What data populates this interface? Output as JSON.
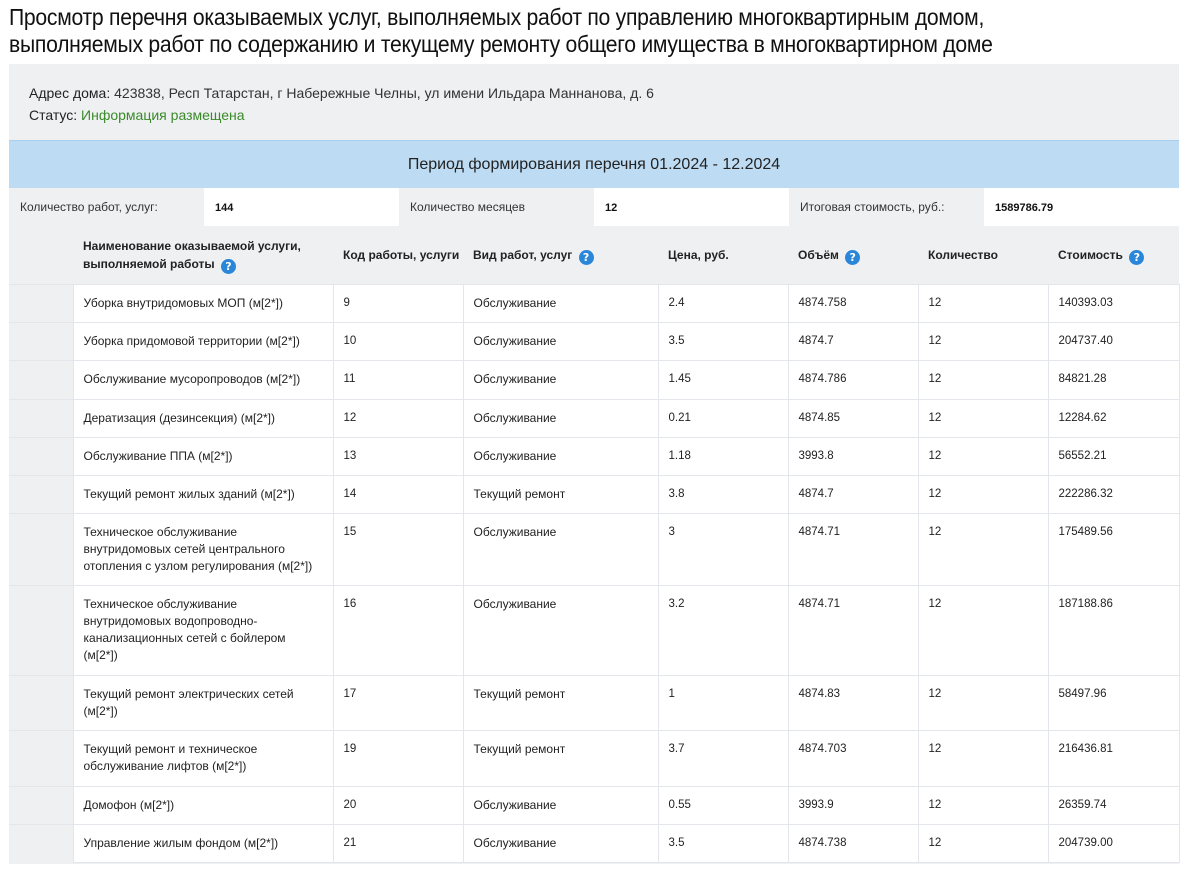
{
  "page": {
    "title_line1": "Просмотр перечня оказываемых услуг, выполняемых работ по управлению многоквартирным домом,",
    "title_line2": "выполняемых работ по содержанию и текущему ремонту общего имущества в многоквартирном доме"
  },
  "info": {
    "address_label": "Адрес дома:",
    "address_value": "423838, Респ Татарстан, г Набережные Челны, ул имени Ильдара Маннанова, д. 6",
    "status_label": "Статус:",
    "status_value": "Информация размещена"
  },
  "period": {
    "label": "Период формирования перечня 01.2024 - 12.2024"
  },
  "stats": {
    "works_label": "Количество работ, услуг:",
    "works_value": "144",
    "months_label": "Количество месяцев",
    "months_value": "12",
    "total_label": "Итоговая стоимость, руб.:",
    "total_value": "1589786.79"
  },
  "table": {
    "headers": {
      "name": "Наименование оказываемой услуги, выполняемой работы",
      "code": "Код работы, услуги",
      "kind": "Вид работ, услуг",
      "price": "Цена, руб.",
      "volume": "Объём",
      "qty": "Количество",
      "cost": "Стоимость"
    },
    "help_icon": "question-circle-icon",
    "rows": [
      {
        "name": "Уборка внутридомовых МОП (м[2*])",
        "code": "9",
        "kind": "Обслуживание",
        "price": "2.4",
        "volume": "4874.758",
        "qty": "12",
        "cost": "140393.03"
      },
      {
        "name": "Уборка придомовой территории (м[2*])",
        "code": "10",
        "kind": "Обслуживание",
        "price": "3.5",
        "volume": "4874.7",
        "qty": "12",
        "cost": "204737.40"
      },
      {
        "name": "Обслуживание мусоропроводов (м[2*])",
        "code": "11",
        "kind": "Обслуживание",
        "price": "1.45",
        "volume": "4874.786",
        "qty": "12",
        "cost": "84821.28"
      },
      {
        "name": "Дератизация (дезинсекция) (м[2*])",
        "code": "12",
        "kind": "Обслуживание",
        "price": "0.21",
        "volume": "4874.85",
        "qty": "12",
        "cost": "12284.62"
      },
      {
        "name": "Обслуживание ППА (м[2*])",
        "code": "13",
        "kind": "Обслуживание",
        "price": "1.18",
        "volume": "3993.8",
        "qty": "12",
        "cost": "56552.21"
      },
      {
        "name": "Текущий ремонт жилых зданий (м[2*])",
        "code": "14",
        "kind": "Текущий ремонт",
        "price": "3.8",
        "volume": "4874.7",
        "qty": "12",
        "cost": "222286.32"
      },
      {
        "name": "Техническое обслуживание внутридомовых сетей центрального отопления с узлом регулирования (м[2*])",
        "code": "15",
        "kind": "Обслуживание",
        "price": "3",
        "volume": "4874.71",
        "qty": "12",
        "cost": "175489.56"
      },
      {
        "name": "Техническое обслуживание внутридомовых водопроводно-канализационных сетей с бойлером (м[2*])",
        "code": "16",
        "kind": "Обслуживание",
        "price": "3.2",
        "volume": "4874.71",
        "qty": "12",
        "cost": "187188.86"
      },
      {
        "name": "Текущий ремонт электрических сетей (м[2*])",
        "code": "17",
        "kind": "Текущий ремонт",
        "price": "1",
        "volume": "4874.83",
        "qty": "12",
        "cost": "58497.96"
      },
      {
        "name": "Текущий ремонт и техническое обслуживание лифтов (м[2*])",
        "code": "19",
        "kind": "Текущий ремонт",
        "price": "3.7",
        "volume": "4874.703",
        "qty": "12",
        "cost": "216436.81"
      },
      {
        "name": "Домофон (м[2*])",
        "code": "20",
        "kind": "Обслуживание",
        "price": "0.55",
        "volume": "3993.9",
        "qty": "12",
        "cost": "26359.74"
      },
      {
        "name": "Управление жилым фондом (м[2*])",
        "code": "21",
        "kind": "Обслуживание",
        "price": "3.5",
        "volume": "4874.738",
        "qty": "12",
        "cost": "204739.00"
      }
    ]
  },
  "colors": {
    "status_ok": "#3a8a2a",
    "period_bg": "#bddcf3",
    "panel_bg": "#eef0f2",
    "help_icon": "#2a86d8"
  }
}
